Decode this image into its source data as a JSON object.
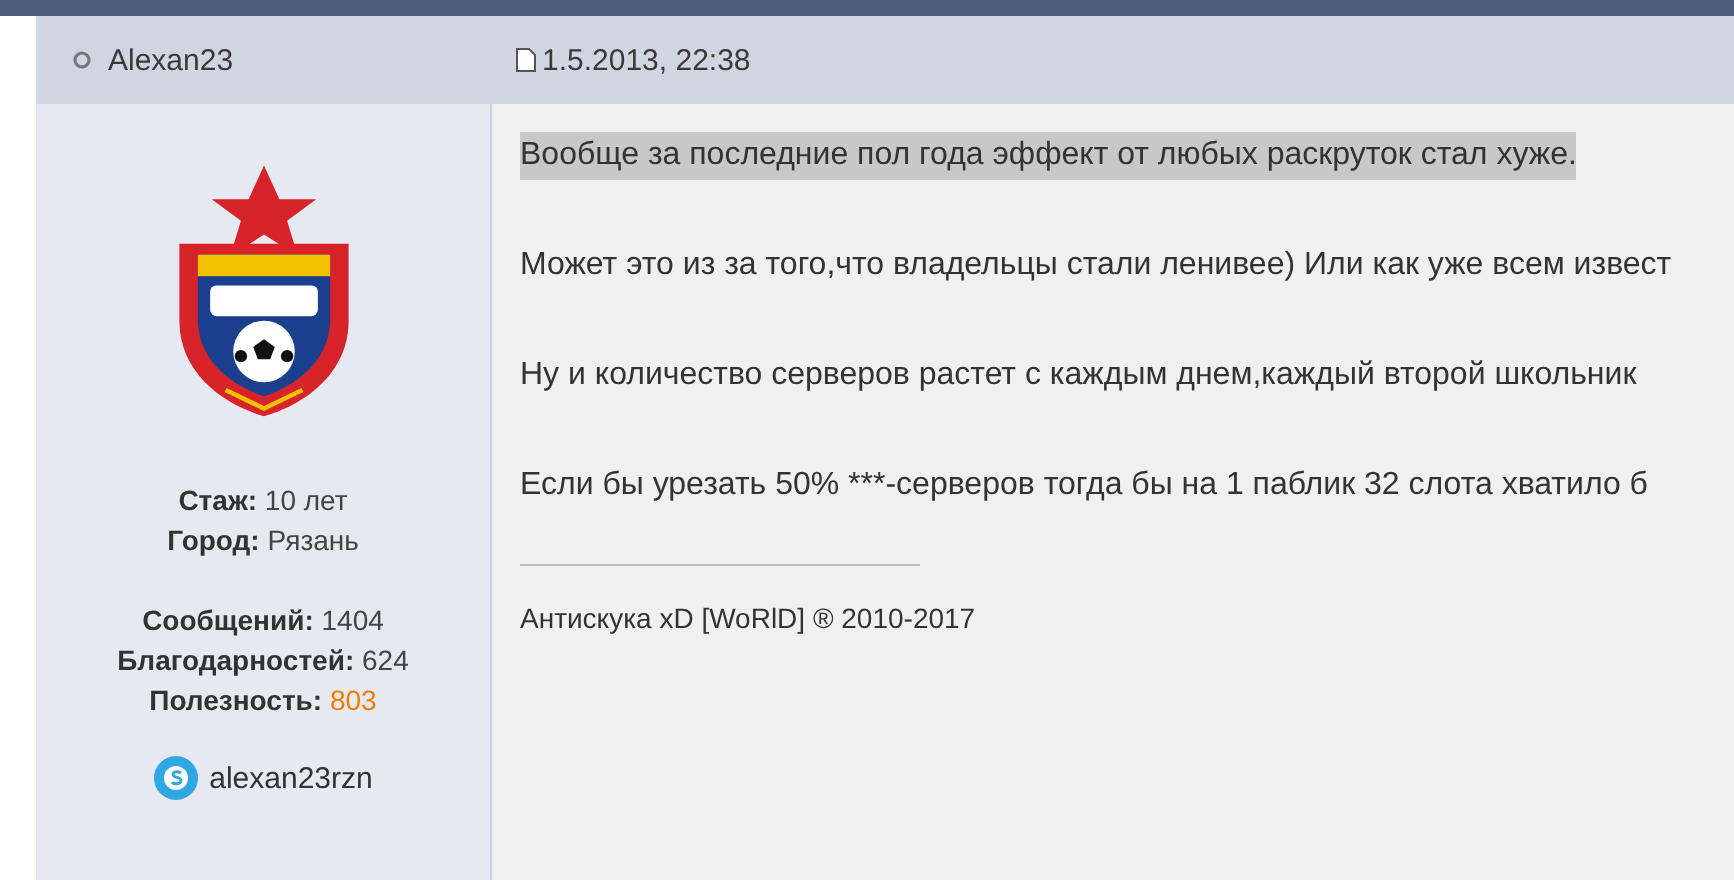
{
  "post": {
    "author": "Alexan23",
    "date": "1.5.2013, 22:38",
    "avatar": {
      "kind": "picture"
    },
    "profile_groups": [
      [
        {
          "label": "Стаж:",
          "value": "10 лет"
        },
        {
          "label": "Город:",
          "value": "Рязань"
        }
      ],
      [
        {
          "label": "Сообщений:",
          "value": "1404"
        },
        {
          "label": "Благодарностей:",
          "value": "624"
        },
        {
          "label": "Полезность:",
          "value": "803",
          "color": "#f07d00"
        }
      ]
    ],
    "skype": "alexan23rzn",
    "paragraphs": [
      {
        "text": "Вообще за последние пол года эффект от любых раскруток стал хуже.",
        "highlighted": true
      },
      {
        "text": "Может это из за того,что владельцы стали ленивее) Или как уже всем извест",
        "highlighted": false
      },
      {
        "text": "Ну и количество серверов растет с каждым днем,каждый второй школьник",
        "highlighted": false
      },
      {
        "text": "Если бы урезать 50% ***-серверов тогда бы на 1 паблик 32 слота хватило б",
        "highlighted": false
      }
    ],
    "signature": "Антискука xD [WoRlD] ® 2010-2017"
  }
}
